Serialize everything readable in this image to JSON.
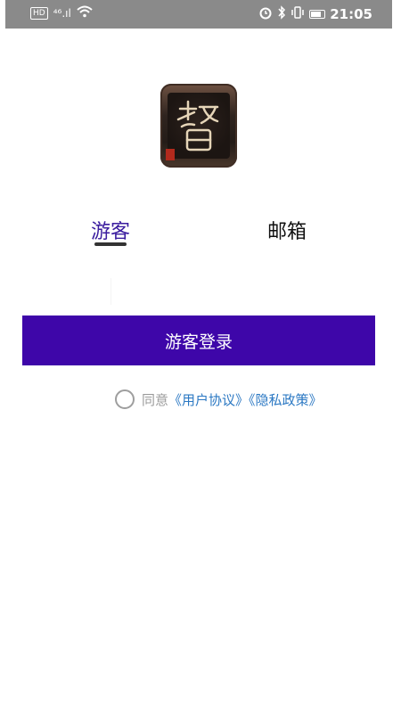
{
  "status_bar": {
    "network_badge": "HD",
    "signal_label": "⁴⁶.ıl",
    "time": "21:05"
  },
  "tabs": [
    {
      "label": "游客"
    },
    {
      "label": "邮箱"
    }
  ],
  "login_button": {
    "label": "游客登录"
  },
  "agreement": {
    "prefix": "同意",
    "user_agreement": "《用户协议》",
    "privacy_policy": "《隐私政策》"
  },
  "colors": {
    "accent": "#3e06a9",
    "active_tab": "#3b1d9f",
    "link": "#2b78c3",
    "status_bar": "#8a8a8a"
  },
  "icons": {
    "logo": "app-logo-calligraphy",
    "status": [
      "wifi-icon",
      "alarm-icon",
      "bluetooth-icon",
      "vibrate-icon",
      "battery-icon"
    ]
  }
}
